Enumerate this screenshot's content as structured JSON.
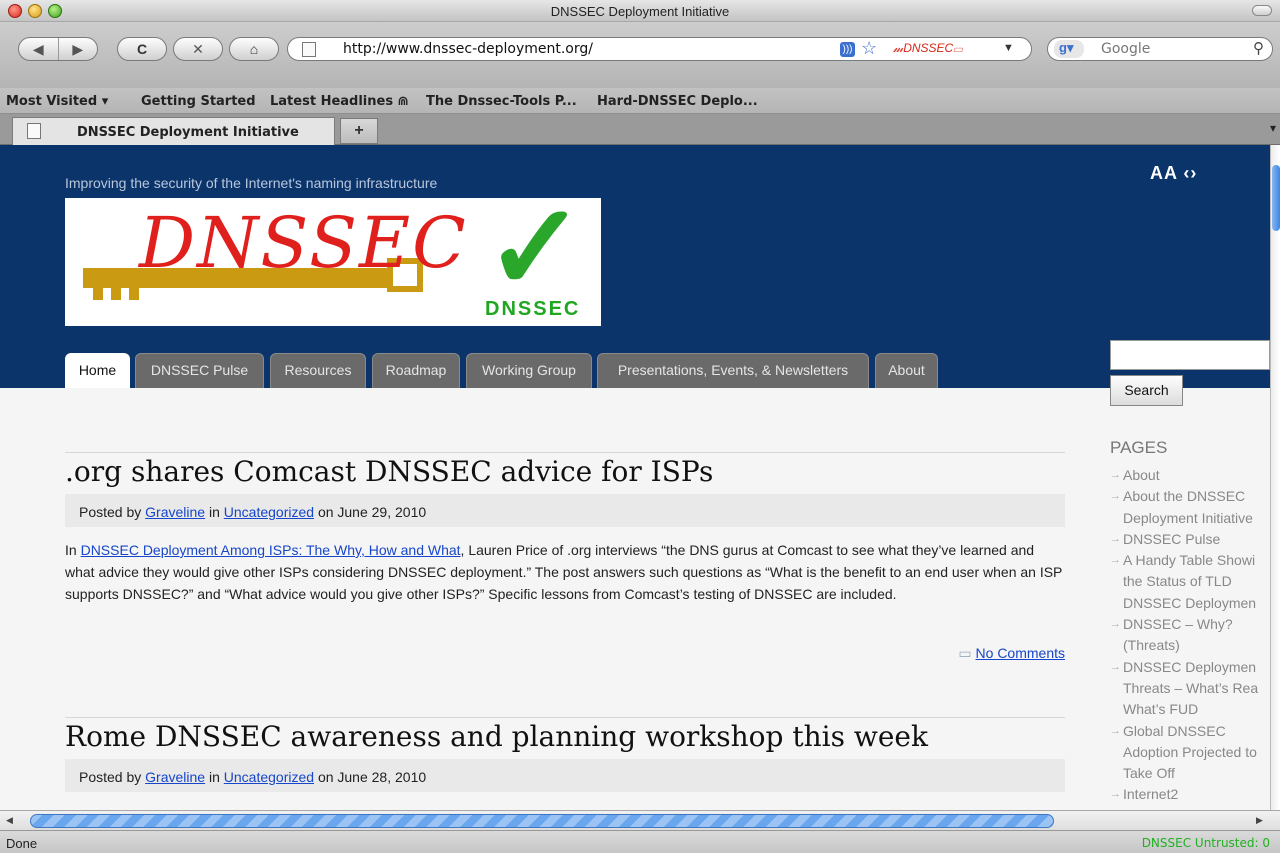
{
  "window": {
    "title": "DNSSEC Deployment Initiative"
  },
  "toolbar": {
    "url": "http://www.dnssec-deployment.org/",
    "search_placeholder": "Google",
    "reload_glyph": "C",
    "stop_glyph": "✕",
    "back_glyph": "◀",
    "forward_glyph": "▶",
    "extension_logo": "𝓂DNSSEC▭"
  },
  "bookmarks": [
    "Most Visited ▾",
    "Getting Started",
    "Latest Headlines ⋒",
    "The Dnssec-Tools P...",
    "Hard-DNSSEC Deplo..."
  ],
  "tabs": [
    {
      "label": "DNSSEC Deployment Initiative"
    }
  ],
  "page": {
    "tagline": "Improving the security of the Internet's naming infrastructure",
    "text_size_control": "AA ‹›",
    "logo_wordmark": "DNSSEC",
    "logo_badge": "DNSSEC",
    "nav": [
      "Home",
      "DNSSEC Pulse",
      "Resources",
      "Roadmap",
      "Working Group",
      "Presentations, Events, & Newsletters",
      "About"
    ],
    "posts": [
      {
        "title": ".org shares Comcast DNSSEC advice for ISPs",
        "posted_by": "Posted by",
        "author": "Graveline",
        "in": "in",
        "category": "Uncategorized",
        "date": "on June 29, 2010",
        "body_prefix": "In",
        "body_link": "DNSSEC Deployment Among ISPs: The Why, How and What",
        "body": ", Lauren Price of .org interviews “the DNS gurus at Comcast to see what they’ve learned and what advice they would give other ISPs considering DNSSEC deployment.” The post answers such questions as “What is the benefit to an end user when an ISP supports DNSSEC?” and “What advice would you give other ISPs?”  Specific lessons from Comcast’s testing of DNSSEC are included.",
        "comments": "No Comments"
      },
      {
        "title": "Rome DNSSEC awareness and planning workshop this week",
        "posted_by": "Posted by",
        "author": "Graveline",
        "in": "in",
        "category": "Uncategorized",
        "date": "on June 28, 2010"
      }
    ],
    "sidebar": {
      "search_button": "Search",
      "pages_heading": "PAGES",
      "pages": [
        "About",
        "About the DNSSEC Deployment Initiative",
        "DNSSEC Pulse",
        "A Handy Table Showi the Status of TLD DNSSEC Deploymen",
        "DNSSEC – Why? (Threats)",
        "DNSSEC Deploymen Threats – What’s Rea What’s FUD",
        "Global DNSSEC Adoption Projected to Take Off",
        "Internet2"
      ]
    }
  },
  "status": {
    "left": "Done",
    "right": "DNSSEC Untrusted:  0"
  }
}
